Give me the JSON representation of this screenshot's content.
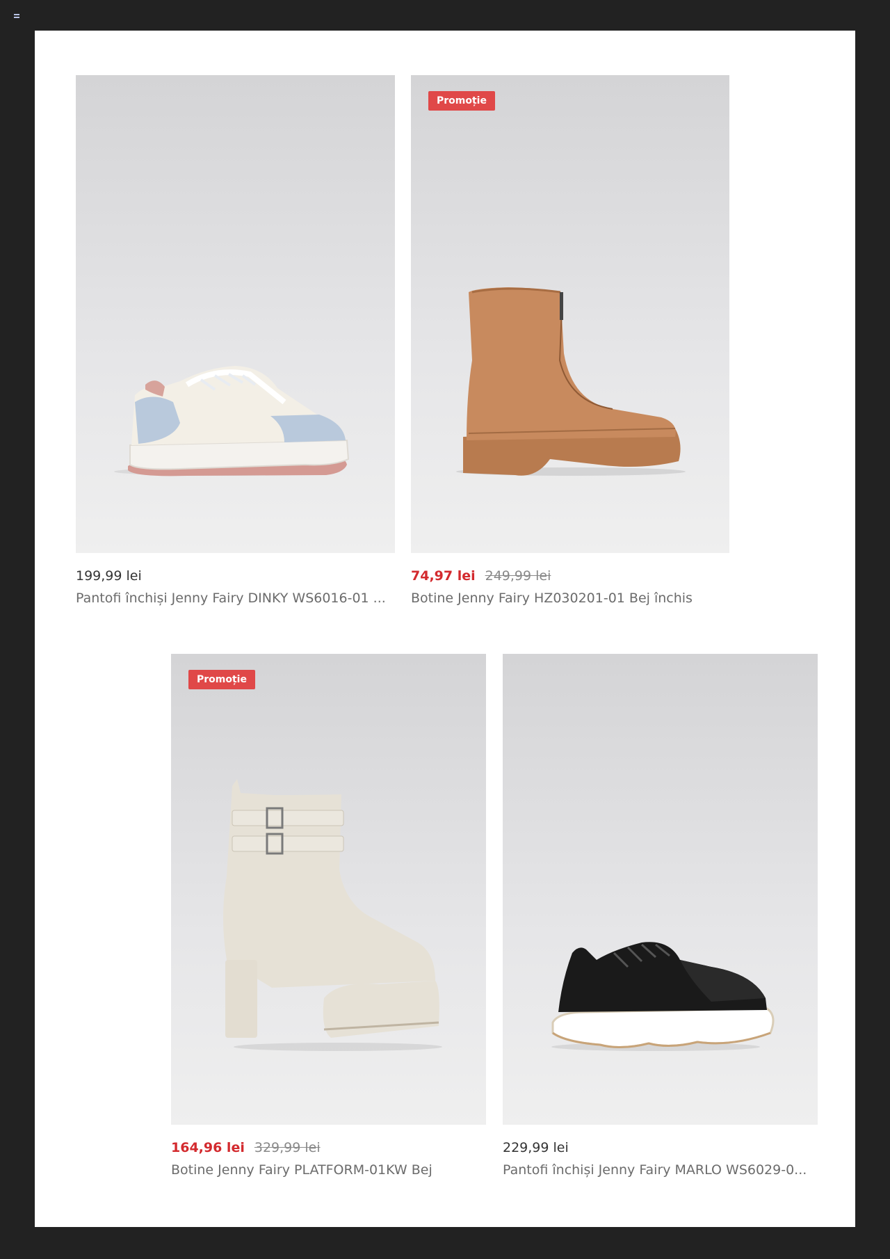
{
  "products": [
    {
      "price": "199,99 lei",
      "title": "Pantofi închiși Jenny Fairy DINKY WS6016-01 ..."
    },
    {
      "badge": "Promoție",
      "price": "74,97 lei",
      "old_price": "249,99 lei",
      "title": "Botine Jenny Fairy HZ030201-01 Bej închis"
    },
    {
      "badge": "Promoție",
      "price": "164,96 lei",
      "old_price": "329,99 lei",
      "title": "Botine Jenny Fairy PLATFORM-01KW Bej"
    },
    {
      "price": "229,99 lei",
      "title": "Pantofi închiși Jenny Fairy MARLO WS6029-0..."
    }
  ]
}
